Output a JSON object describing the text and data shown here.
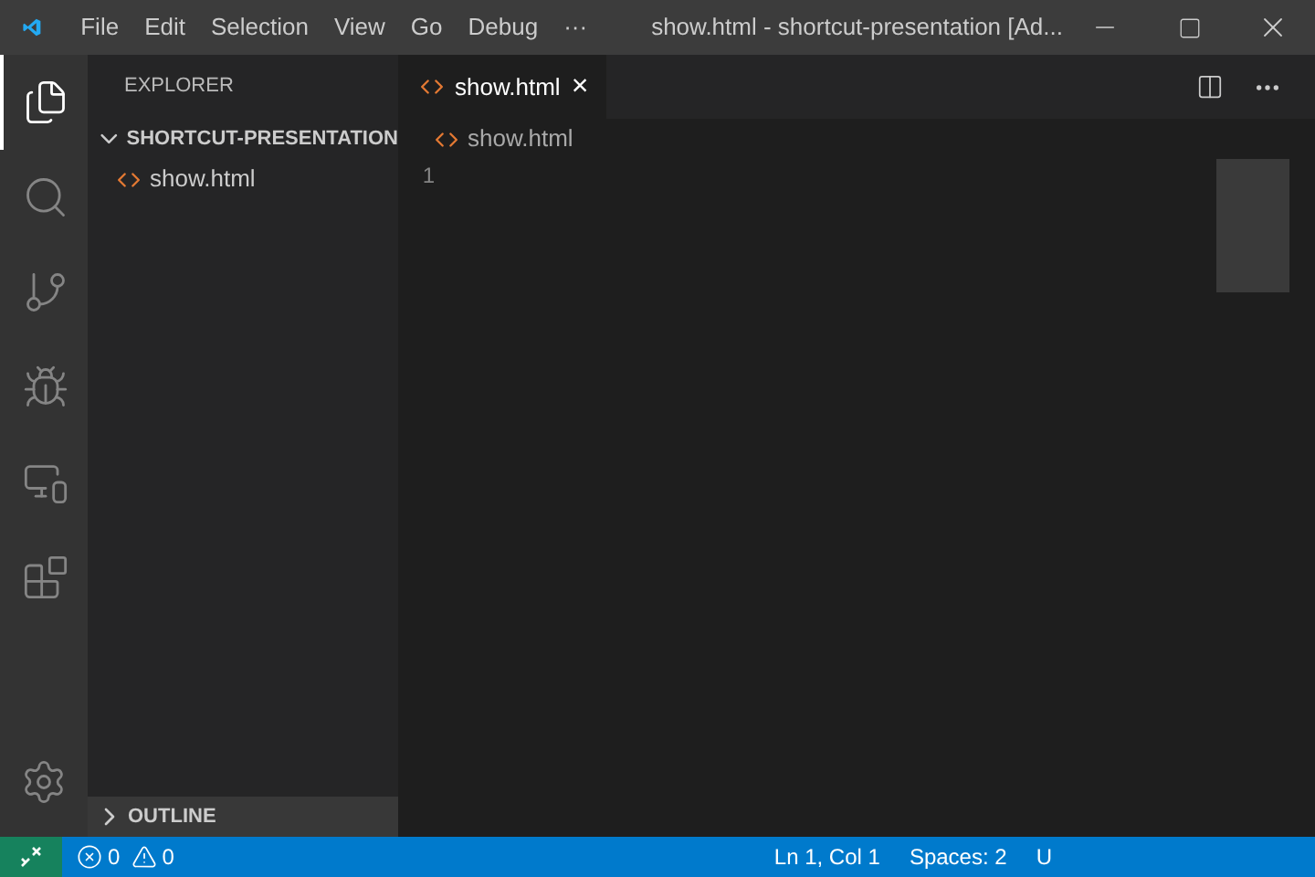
{
  "window": {
    "title": "show.html - shortcut-presentation [Ad..."
  },
  "menu": [
    "File",
    "Edit",
    "Selection",
    "View",
    "Go",
    "Debug",
    "···"
  ],
  "activity_bar": [
    {
      "kind": "explorer",
      "selected": true
    },
    {
      "kind": "search",
      "selected": false
    },
    {
      "kind": "source-control",
      "selected": false
    },
    {
      "kind": "debug",
      "selected": false
    },
    {
      "kind": "remote",
      "selected": false
    },
    {
      "kind": "extensions",
      "selected": false
    }
  ],
  "sidebar": {
    "title": "EXPLORER",
    "sections": [
      {
        "label": "SHORTCUT-PRESENTATION",
        "expanded": true,
        "files": [
          "show.html"
        ]
      }
    ],
    "outline": {
      "label": "OUTLINE",
      "expanded": false
    }
  },
  "tabs": [
    {
      "label": "show.html",
      "selected": true,
      "close": "×"
    }
  ],
  "breadcrumb": "show.html",
  "editor": {
    "line_numbers": [
      "1"
    ]
  },
  "status_bar": {
    "errors": "0",
    "warnings": "0",
    "items": [
      "Ln 1, Col 1",
      "Spaces: 2",
      "U"
    ]
  }
}
